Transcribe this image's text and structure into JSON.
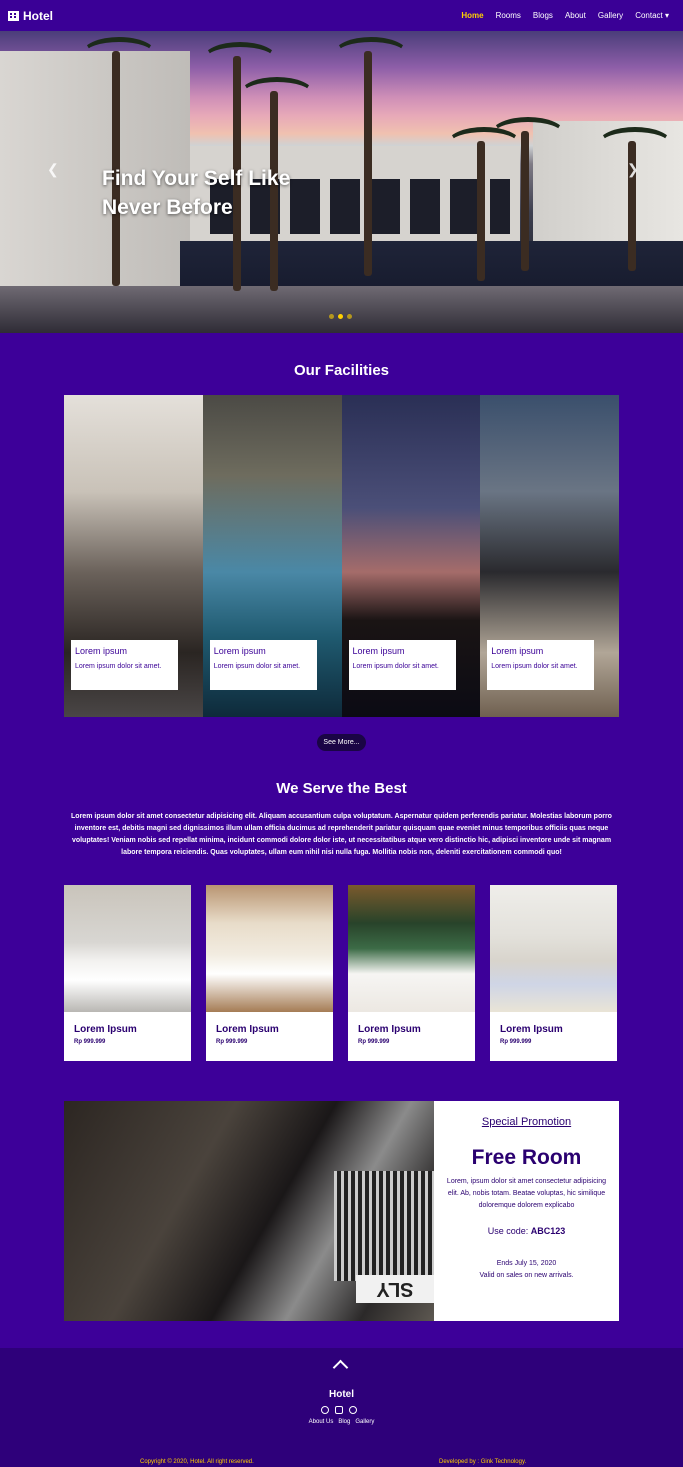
{
  "nav": {
    "brand": "Hotel",
    "links": [
      "Home",
      "Rooms",
      "Blogs",
      "About",
      "Gallery",
      "Contact ▾"
    ],
    "active": "Home"
  },
  "hero": {
    "title_line1": "Find Your Self Like",
    "title_line2": "Never Before",
    "slides": 3,
    "active_slide": 2
  },
  "facilities": {
    "title": "Our Facilities",
    "cards": [
      {
        "title": "Lorem ipsum",
        "text": "Lorem ipsum dolor sit amet."
      },
      {
        "title": "Lorem ipsum",
        "text": "Lorem ipsum dolor sit amet."
      },
      {
        "title": "Lorem ipsum",
        "text": "Lorem ipsum dolor sit amet."
      },
      {
        "title": "Lorem ipsum",
        "text": "Lorem ipsum dolor sit amet."
      }
    ],
    "see_more": "See More..."
  },
  "serve": {
    "title": "We Serve the Best",
    "text": "Lorem ipsum dolor sit amet consectetur adipisicing elit. Aliquam accusantium culpa voluptatum. Aspernatur quidem perferendis pariatur. Molestias laborum porro inventore est, debitis magni sed dignissimos illum ullam officia ducimus ad reprehenderit pariatur quisquam quae eveniet minus temporibus officiis quas neque voluptates! Veniam nobis sed repellat minima, incidunt commodi dolore dolor iste, ut necessitatibus atque vero distinctio hic, adipisci inventore unde sit magnam labore tempora reiciendis. Quas voluptates, ullam eum nihil nisi nulla fuga. Mollitia nobis non, deleniti exercitationem commodi quo!"
  },
  "rooms": [
    {
      "name": "Lorem Ipsum",
      "price": "Rp 999.999"
    },
    {
      "name": "Lorem Ipsum",
      "price": "Rp 999.999"
    },
    {
      "name": "Lorem Ipsum",
      "price": "Rp 999.999"
    },
    {
      "name": "Lorem Ipsum",
      "price": "Rp 999.999"
    }
  ],
  "promo": {
    "label": "Special Promotion",
    "title": "Free Room",
    "desc": "Lorem, ipsum dolor sit amet consectetur adipisicing elit. Ab, nobis totam. Beatae voluptas, hic similique doloremque dolorem explicabo",
    "code_label": "Use code:",
    "code": "ABC123",
    "ends": "Ends July 15, 2020",
    "valid": "Valid on sales on new arrivals.",
    "plate": "SLY"
  },
  "footer": {
    "name": "Hotel",
    "links": [
      "About Us",
      "Blog",
      "Gallery"
    ],
    "icons": [
      "whatsapp-icon",
      "instagram-icon",
      "dribbble-icon"
    ],
    "copyright": "Copyright © 2020, Hotel. All right reserved.",
    "developer": "Developed by : Gink Technology."
  },
  "colors": {
    "primary": "#3d0099",
    "accent": "#ffd000",
    "footer": "#2e007a"
  }
}
